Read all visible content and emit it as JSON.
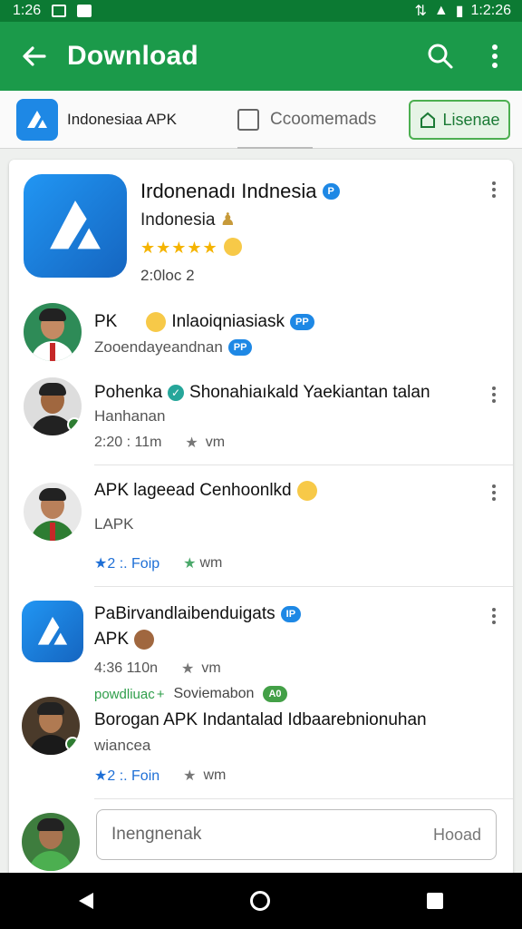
{
  "status_bar": {
    "time_left": "1:26",
    "time_right": "1:2:26"
  },
  "app_bar": {
    "title": "Download"
  },
  "tabs": {
    "app_name": "Indonesiaa APK",
    "comments": "Ccoomemads",
    "license_button": "Lisenae"
  },
  "header": {
    "title": "Irdonenadı Indnesia",
    "title_badge": "P",
    "subtitle": "Indonesia",
    "stars": "★★★★★",
    "downloads": "2:0loc 2"
  },
  "comments": [
    {
      "name": "PK",
      "text": "Inlaoiqniasiask",
      "badge": "PP",
      "line2": "Zooendayeandnan",
      "line2_badge": "PP"
    },
    {
      "name": "Pohenka",
      "text": "Shonahiaıkald Yaekiantan talan",
      "line2": "Hanhanan",
      "time": "2:20 : 11m",
      "wm": "vm"
    },
    {
      "name": "APK lageead Cenhoonlkd",
      "line2": "LAPK",
      "rating": "2 :. Foip",
      "wm": "wm"
    },
    {
      "name": "PaBirvandlaibenduigats",
      "badge": "IP",
      "line2": "APK",
      "time": "4:36 110n",
      "wm": "vm"
    },
    {
      "green_label": "powdliuac",
      "plus": "+",
      "name_right": "Soviemabon",
      "green_badge": "A0",
      "text": "Borogan APK Indantalad Idbaarebnionuhan",
      "line2": "wiancea",
      "rating": "2 :. Foin",
      "wm": "wm"
    }
  ],
  "input": {
    "placeholder": "Inengnenak",
    "upload": "Hooad"
  },
  "colors": {
    "status_bar": "#0c7a33",
    "app_bar": "#1b9a4a",
    "accent_blue": "#1e88e5"
  }
}
